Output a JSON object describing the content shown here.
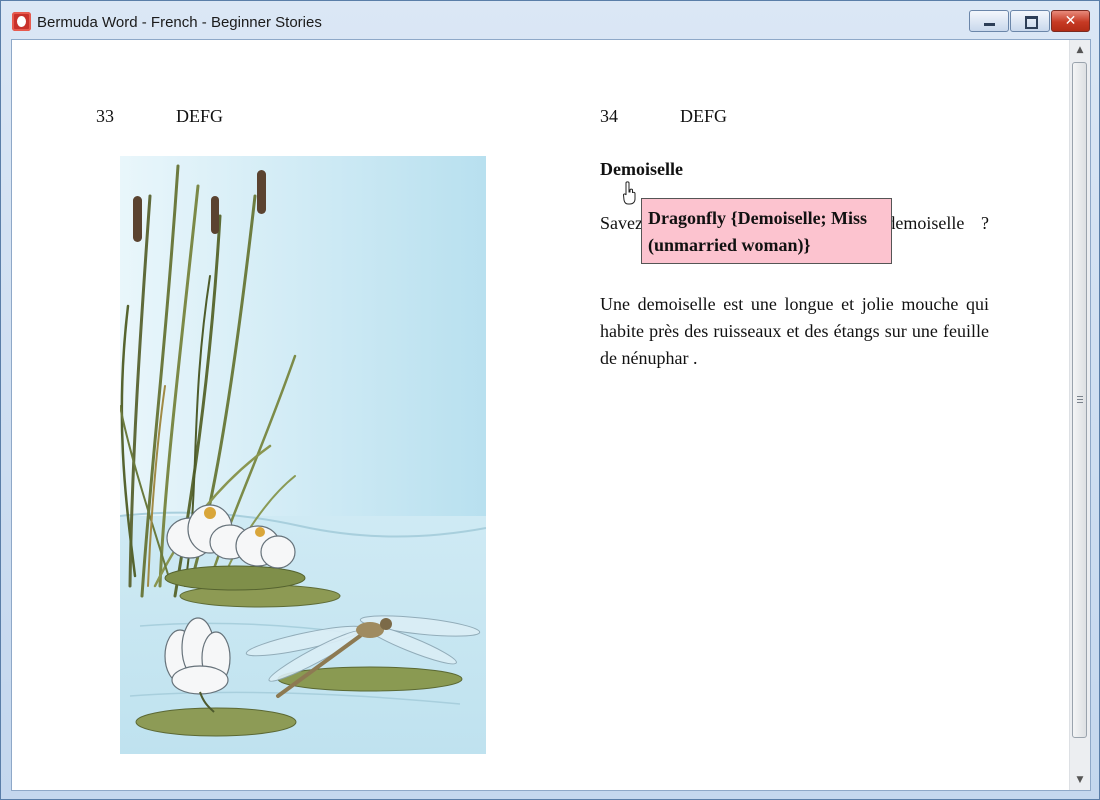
{
  "window": {
    "title": "Bermuda Word - French - Beginner Stories",
    "controls": {
      "minimize": "minimize-icon",
      "maximize": "maximize-icon",
      "close": "close-icon"
    }
  },
  "left_page": {
    "page_number": "33",
    "header": "DEFG"
  },
  "right_page": {
    "page_number": "34",
    "header": "DEFG",
    "story_title": "Demoiselle",
    "paragraph_1": "Savez-vous ce que c'est qu'une demoiselle ?",
    "paragraph_2": "Une demoiselle est une longue et jolie mouche qui habite près des ruisseaux et des étangs sur une feuille de nénuphar ."
  },
  "tooltip": {
    "text": "Dragonfly {Demoiselle; Miss (unmarried woman)}"
  },
  "colors": {
    "tooltip_bg": "#fcc3cf",
    "close_button": "#c63a24",
    "page_bg": "#ffffff"
  },
  "icons": {
    "app": "bermuda-word-app-icon",
    "cursor": "hand-pointer-icon"
  }
}
